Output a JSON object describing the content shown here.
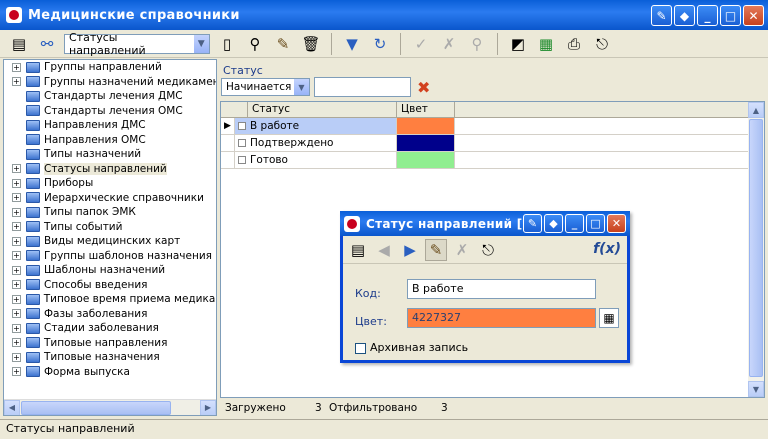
{
  "window": {
    "title": "Медицинские справочники"
  },
  "toolbar": {
    "dictionary_combo": "Статусы направлений"
  },
  "tree": {
    "items": [
      {
        "label": "Группы направлений",
        "expandable": true
      },
      {
        "label": "Группы назначений медикаментов",
        "expandable": true
      },
      {
        "label": "Стандарты лечения ДМС",
        "expandable": false
      },
      {
        "label": "Стандарты лечения ОМС",
        "expandable": false
      },
      {
        "label": "Направления ДМС",
        "expandable": false
      },
      {
        "label": "Направления ОМС",
        "expandable": false
      },
      {
        "label": "Типы назначений",
        "expandable": false
      },
      {
        "label": "Статусы направлений",
        "expandable": true,
        "selected": true
      },
      {
        "label": "Приборы",
        "expandable": true
      },
      {
        "label": "Иерархические справочники",
        "expandable": true
      },
      {
        "label": "Типы папок ЭМК",
        "expandable": true
      },
      {
        "label": "Типы событий",
        "expandable": true
      },
      {
        "label": "Виды медицинских карт",
        "expandable": true
      },
      {
        "label": "Группы шаблонов назначения",
        "expandable": true
      },
      {
        "label": "Шаблоны назначений",
        "expandable": true
      },
      {
        "label": "Способы введения",
        "expandable": true
      },
      {
        "label": "Типовое время приема медикаментов",
        "expandable": true
      },
      {
        "label": "Фазы заболевания",
        "expandable": true
      },
      {
        "label": "Стадии заболевания",
        "expandable": true
      },
      {
        "label": "Типовые направления",
        "expandable": true
      },
      {
        "label": "Типовые назначения",
        "expandable": true
      },
      {
        "label": "Форма выпуска",
        "expandable": true
      }
    ]
  },
  "filter": {
    "label": "Статус",
    "mode": "Начинается",
    "value": ""
  },
  "grid": {
    "columns": [
      "Статус",
      "Цвет"
    ],
    "rows": [
      {
        "status": "В работе",
        "color": "#ff7f40",
        "current": true
      },
      {
        "status": "Подтверждено",
        "color": "#00008b",
        "current": false
      },
      {
        "status": "Готово",
        "color": "#90ee90",
        "current": false
      }
    ]
  },
  "counts": {
    "loaded_label": "Загружено",
    "loaded": "3",
    "filtered_label": "Отфильтровано",
    "filtered": "3"
  },
  "statusbar": {
    "text": "Статусы направлений"
  },
  "dialog": {
    "title": "Статус направлений [редактирование]",
    "code_label": "Код:",
    "code_value": "В работе",
    "color_label": "Цвет:",
    "color_value": "4227327",
    "color_hex": "#ff7f40",
    "archive_label": "Архивная запись",
    "fx": "f(x)"
  }
}
